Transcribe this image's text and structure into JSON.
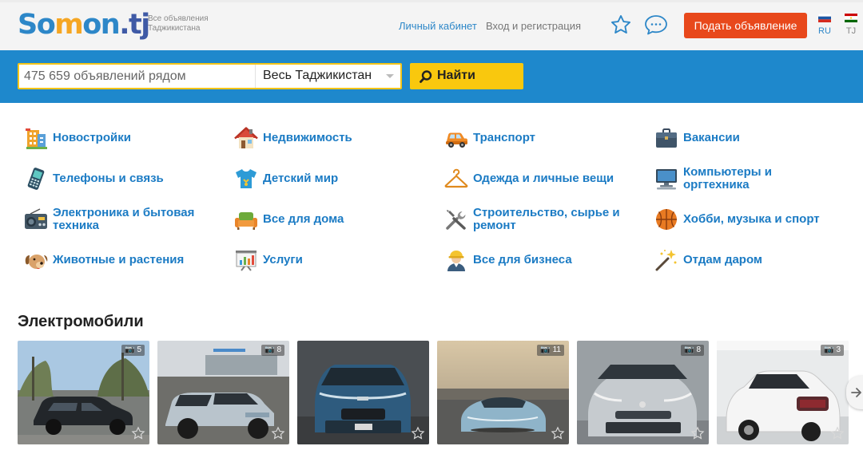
{
  "header": {
    "logo": {
      "part1": "So",
      "part2": "m",
      "part3": "on",
      "part4": ".tj"
    },
    "tagline": "Все объявления Таджикистана",
    "cabinet_link": "Личный кабинет",
    "login_link": "Вход и регистрация",
    "post_button": "Подать объявление",
    "languages": [
      {
        "code": "RU",
        "active": true
      },
      {
        "code": "TJ",
        "active": false
      }
    ]
  },
  "search": {
    "placeholder": "475 659 объявлений рядом",
    "region": "Весь Таджикистан",
    "button": "Найти"
  },
  "colors": {
    "brand_blue": "#1e88cc",
    "link_blue": "#1b7bc4",
    "accent_yellow": "#f9c80e",
    "post_orange": "#e8481b"
  },
  "categories": [
    {
      "label": "Новостройки",
      "icon": "building-icon"
    },
    {
      "label": "Недвижимость",
      "icon": "house-icon"
    },
    {
      "label": "Транспорт",
      "icon": "car-icon"
    },
    {
      "label": "Вакансии",
      "icon": "briefcase-icon"
    },
    {
      "label": "Телефоны и связь",
      "icon": "phone-icon"
    },
    {
      "label": "Детский мир",
      "icon": "kids-shirt-icon"
    },
    {
      "label": "Одежда и личные вещи",
      "icon": "hanger-icon"
    },
    {
      "label": "Компьютеры и оргтехника",
      "icon": "computer-icon"
    },
    {
      "label": "Электроника и бытовая техника",
      "icon": "radio-icon"
    },
    {
      "label": "Все для дома",
      "icon": "sofa-icon"
    },
    {
      "label": "Строительство, сырье и ремонт",
      "icon": "tools-icon"
    },
    {
      "label": "Хобби, музыка и спорт",
      "icon": "ball-icon"
    },
    {
      "label": "Животные и растения",
      "icon": "dog-icon"
    },
    {
      "label": "Услуги",
      "icon": "chart-board-icon"
    },
    {
      "label": "Все для бизнеса",
      "icon": "worker-icon"
    },
    {
      "label": "Отдам даром",
      "icon": "magic-wand-icon"
    }
  ],
  "listings": {
    "title": "Электромобили",
    "items": [
      {
        "photos": "5"
      },
      {
        "photos": "8"
      },
      {
        "photos": ""
      },
      {
        "photos": "11"
      },
      {
        "photos": "8"
      },
      {
        "photos": "3"
      }
    ]
  }
}
